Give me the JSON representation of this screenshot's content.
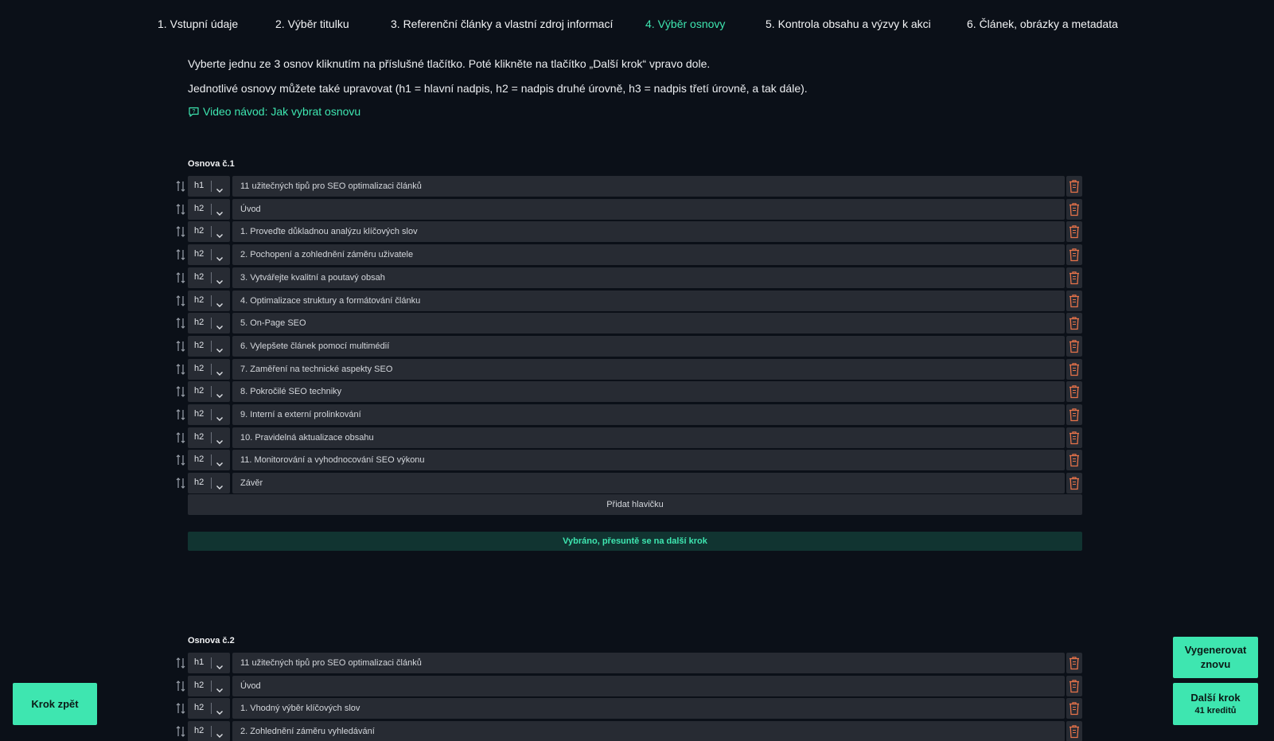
{
  "steps": [
    {
      "label": "1. Vstupní údaje",
      "active": false
    },
    {
      "label": "2. Výběr titulku",
      "active": false
    },
    {
      "label": "3. Referenční články a vlastní zdroj informací",
      "active": false
    },
    {
      "label": "4. Výběr osnovy",
      "active": true
    },
    {
      "label": "5. Kontrola obsahu a výzvy k akci",
      "active": false
    },
    {
      "label": "6. Článek, obrázky a metadata",
      "active": false
    }
  ],
  "instructions": {
    "line1": "Vyberte jednu ze 3 osnov kliknutím na příslušné tlačítko. Poté klikněte na tlačítko „Další krok“ vpravo dole.",
    "line2": "Jednotlivé osnovy můžete také upravovat (h1 = hlavní nadpis, h2 = nadpis druhé úrovně, h3 = nadpis třetí úrovně, a tak dále).",
    "video_link": "Video návod: Jak vybrat osnovu"
  },
  "outlines": [
    {
      "title": "Osnova č.1",
      "add_label": "Přidat hlavičku",
      "selected_label": "Vybráno, přesuntě se na další krok",
      "rows": [
        {
          "level": "h1",
          "text": "11 užitečných tipů pro SEO optimalizaci článků"
        },
        {
          "level": "h2",
          "text": "Úvod"
        },
        {
          "level": "h2",
          "text": "1. Proveďte důkladnou analýzu klíčových slov"
        },
        {
          "level": "h2",
          "text": "2. Pochopení a zohlednění záměru uživatele"
        },
        {
          "level": "h2",
          "text": "3. Vytvářejte kvalitní a poutavý obsah"
        },
        {
          "level": "h2",
          "text": "4. Optimalizace struktury a formátování článku"
        },
        {
          "level": "h2",
          "text": "5. On-Page SEO"
        },
        {
          "level": "h2",
          "text": "6. Vylepšete článek pomocí multimédií"
        },
        {
          "level": "h2",
          "text": "7. Zaměření na technické aspekty SEO"
        },
        {
          "level": "h2",
          "text": "8. Pokročilé SEO techniky"
        },
        {
          "level": "h2",
          "text": "9. Interní a externí prolinkování"
        },
        {
          "level": "h2",
          "text": "10. Pravidelná aktualizace obsahu"
        },
        {
          "level": "h2",
          "text": "11. Monitorování a vyhodnocování SEO výkonu"
        },
        {
          "level": "h2",
          "text": "Závěr"
        }
      ]
    },
    {
      "title": "Osnova č.2",
      "rows": [
        {
          "level": "h1",
          "text": "11 užitečných tipů pro SEO optimalizaci článků"
        },
        {
          "level": "h2",
          "text": "Úvod"
        },
        {
          "level": "h2",
          "text": "1. Vhodný výběr klíčových slov"
        },
        {
          "level": "h2",
          "text": "2. Zohlednění záměru vyhledávání"
        }
      ]
    }
  ],
  "buttons": {
    "back": "Krok zpět",
    "regenerate_line1": "Vygenerovat",
    "regenerate_line2": "znovu",
    "next": "Další krok",
    "next_credits": "41 kreditů"
  },
  "colors": {
    "accent": "#3ee6b0",
    "background": "#0b1018",
    "field": "#272b33",
    "trash": "#e8734a"
  }
}
